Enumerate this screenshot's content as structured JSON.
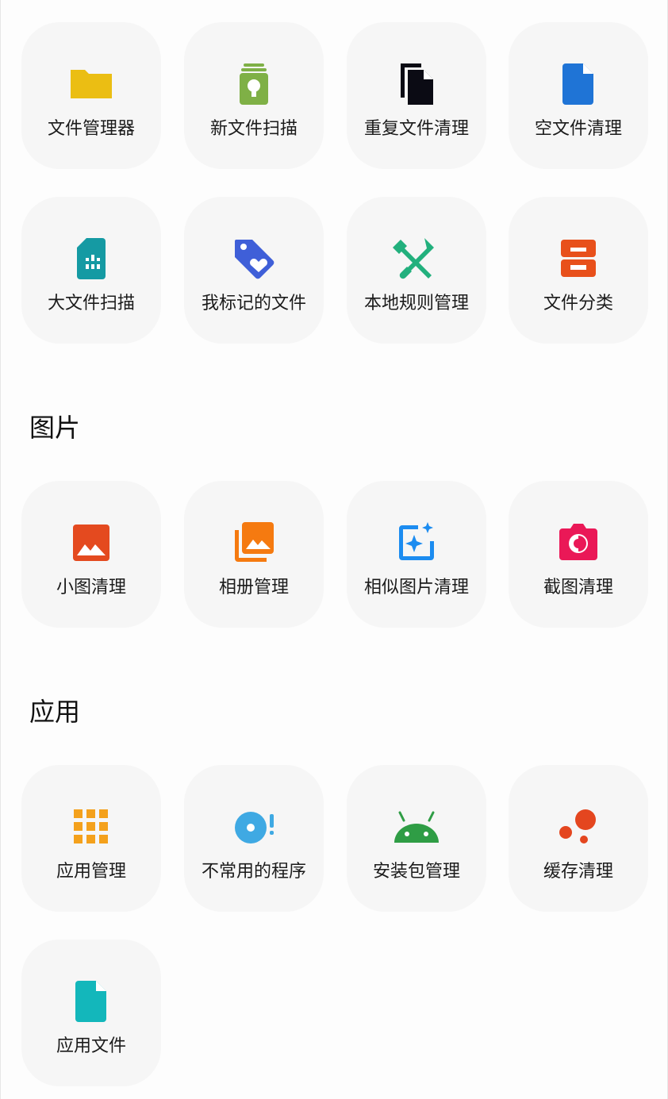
{
  "files_section": {
    "items": [
      {
        "label": "文件管理器",
        "icon": "folder-icon",
        "color": "#EBBE13"
      },
      {
        "label": "新文件扫描",
        "icon": "new-file-scan-icon",
        "color": "#7FB046"
      },
      {
        "label": "重复文件清理",
        "icon": "duplicate-files-icon",
        "color": "#0B0B14"
      },
      {
        "label": "空文件清理",
        "icon": "empty-file-icon",
        "color": "#1F74D6"
      },
      {
        "label": "大文件扫描",
        "icon": "sd-card-icon",
        "color": "#159AA3"
      },
      {
        "label": "我标记的文件",
        "icon": "heart-tag-icon",
        "color": "#3F5FD8"
      },
      {
        "label": "本地规则管理",
        "icon": "tools-icon",
        "color": "#22B07D"
      },
      {
        "label": "文件分类",
        "icon": "inbox-tray-icon",
        "color": "#E8501B"
      }
    ]
  },
  "images_section": {
    "title": "图片",
    "items": [
      {
        "label": "小图清理",
        "icon": "image-icon",
        "color": "#E44A1F"
      },
      {
        "label": "相册管理",
        "icon": "photo-library-icon",
        "color": "#F57A10"
      },
      {
        "label": "相似图片清理",
        "icon": "sparkle-image-icon",
        "color": "#1C8CF0"
      },
      {
        "label": "截图清理",
        "icon": "camera-icon",
        "color": "#EA1857"
      }
    ]
  },
  "apps_section": {
    "title": "应用",
    "items": [
      {
        "label": "应用管理",
        "icon": "app-grid-icon",
        "color": "#F4A11C"
      },
      {
        "label": "不常用的程序",
        "icon": "unused-app-icon",
        "color": "#3FA9E3"
      },
      {
        "label": "安装包管理",
        "icon": "android-icon",
        "color": "#2F9D45"
      },
      {
        "label": "缓存清理",
        "icon": "cache-bubbles-icon",
        "color": "#E4461F"
      },
      {
        "label": "应用文件",
        "icon": "app-file-icon",
        "color": "#13B7BB"
      }
    ]
  }
}
